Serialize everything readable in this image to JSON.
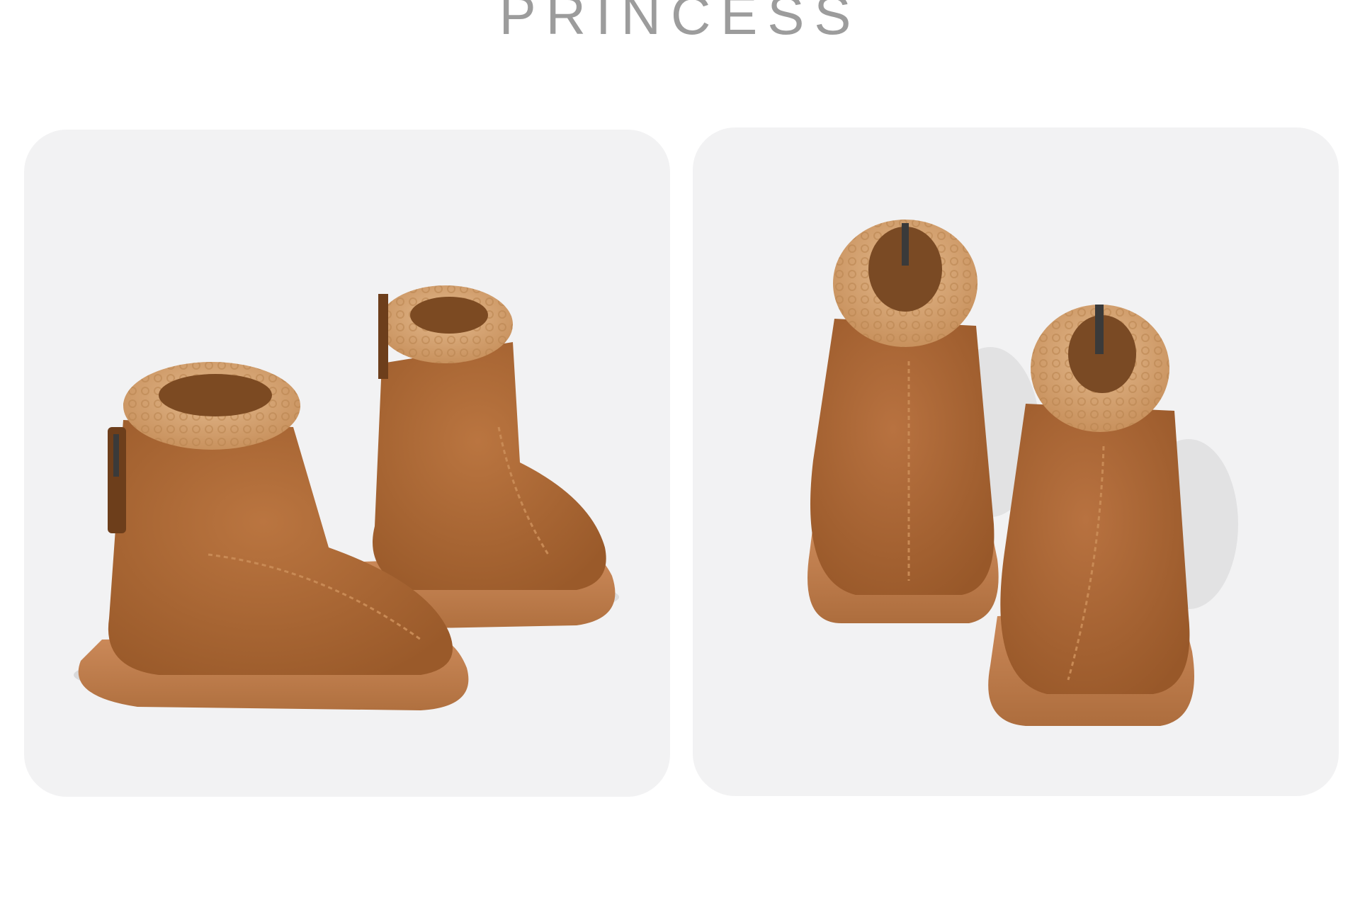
{
  "header": {
    "brand_text": "PRINCESS"
  },
  "panels": [
    {
      "subject": "boots-pair-side-view"
    },
    {
      "subject": "boots-pair-back-view"
    }
  ],
  "colors": {
    "background": "#ffffff",
    "panel": "#f2f2f3",
    "suede": "#b06a34",
    "suede_dark": "#8e5226",
    "sole": "#c07f52",
    "fleece": "#d8aa7c",
    "title": "#9c9c9c"
  }
}
